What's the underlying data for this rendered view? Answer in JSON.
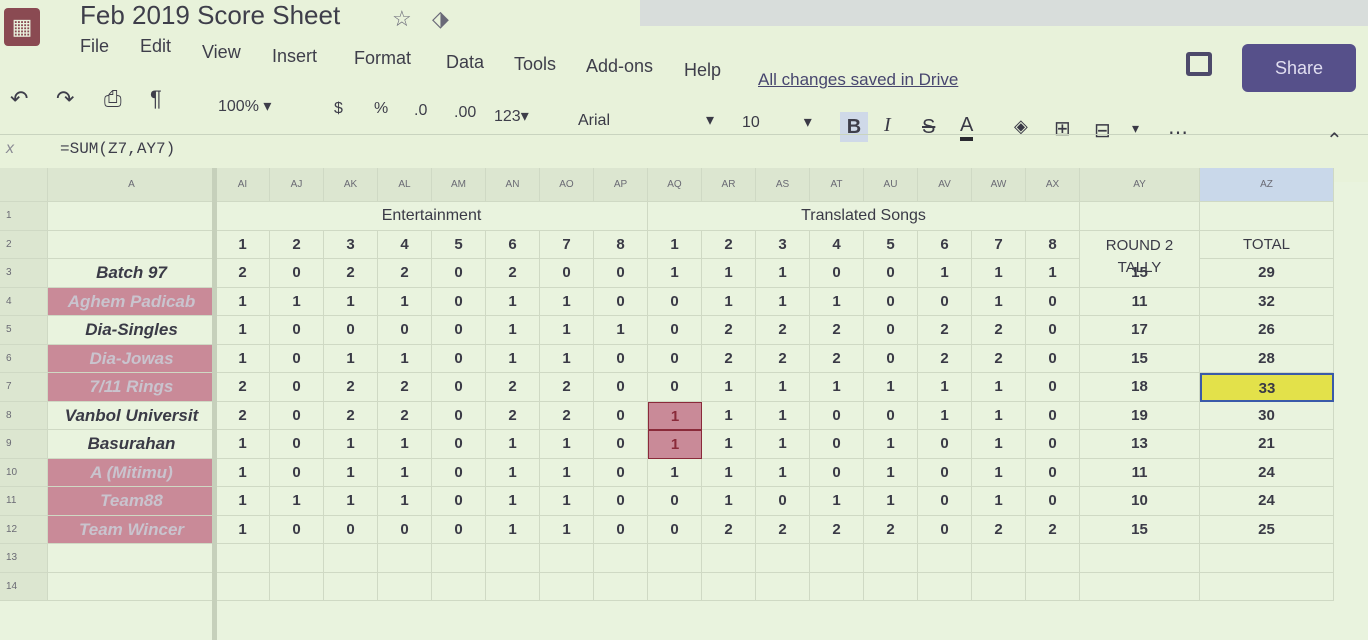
{
  "app": {
    "doc_title": "Feb 2019 Score Sheet",
    "status": "All changes saved in Drive",
    "share_label": "Share"
  },
  "menu": [
    "File",
    "Edit",
    "View",
    "Insert",
    "Format",
    "Data",
    "Tools",
    "Add-ons",
    "Help"
  ],
  "toolbar": {
    "zoom": "100%",
    "currency": "$",
    "percent": "%",
    "dec_less": ".0",
    "dec_more": ".00",
    "format_more": "123",
    "font": "Arial",
    "font_size": "10",
    "bold": "B",
    "italic": "I",
    "strike": "S",
    "text_color": "A"
  },
  "formula": {
    "text": "=SUM(Z7,AY7)"
  },
  "columns": {
    "a": "A",
    "letters": [
      "AI",
      "AJ",
      "AK",
      "AL",
      "AM",
      "AN",
      "AO",
      "AP",
      "AQ",
      "AR",
      "AS",
      "AT",
      "AU",
      "AV",
      "AW",
      "AX"
    ],
    "ay": "AY",
    "az": "AZ"
  },
  "sections": {
    "entertainment": "Entertainment",
    "translated": "Translated Songs",
    "round2": "ROUND 2",
    "tally": "TALLY",
    "total": "TOTAL"
  },
  "row_numbers": [
    "1",
    "2",
    "3",
    "4",
    "5",
    "6",
    "7",
    "8",
    "9",
    "10",
    "11",
    "12",
    "13",
    "14"
  ],
  "subheaders": [
    "1",
    "2",
    "3",
    "4",
    "5",
    "6",
    "7",
    "8",
    "1",
    "2",
    "3",
    "4",
    "5",
    "6",
    "7",
    "8"
  ],
  "teams": [
    {
      "name": "Batch 97",
      "scores": [
        "2",
        "0",
        "2",
        "2",
        "0",
        "2",
        "0",
        "0",
        "1",
        "1",
        "1",
        "0",
        "0",
        "1",
        "1",
        "1"
      ],
      "tally": "15",
      "total": "29"
    },
    {
      "name": "Aghem Padicab",
      "scores": [
        "1",
        "1",
        "1",
        "1",
        "0",
        "1",
        "1",
        "0",
        "0",
        "1",
        "1",
        "1",
        "0",
        "0",
        "1",
        "0"
      ],
      "tally": "11",
      "total": "32"
    },
    {
      "name": "Dia-Singles",
      "scores": [
        "1",
        "0",
        "0",
        "0",
        "0",
        "1",
        "1",
        "1",
        "0",
        "2",
        "2",
        "2",
        "0",
        "2",
        "2",
        "0"
      ],
      "tally": "17",
      "total": "26"
    },
    {
      "name": "Dia-Jowas",
      "scores": [
        "1",
        "0",
        "1",
        "1",
        "0",
        "1",
        "1",
        "0",
        "0",
        "2",
        "2",
        "2",
        "0",
        "2",
        "2",
        "0"
      ],
      "tally": "15",
      "total": "28"
    },
    {
      "name": "7/11 Rings",
      "scores": [
        "2",
        "0",
        "2",
        "2",
        "0",
        "2",
        "2",
        "0",
        "0",
        "1",
        "1",
        "1",
        "1",
        "1",
        "1",
        "0"
      ],
      "tally": "18",
      "total": "33"
    },
    {
      "name": "Vanbol Universit",
      "scores": [
        "2",
        "0",
        "2",
        "2",
        "0",
        "2",
        "2",
        "0",
        "1",
        "1",
        "1",
        "0",
        "0",
        "1",
        "1",
        "0"
      ],
      "tally": "19",
      "total": "30"
    },
    {
      "name": "Basurahan",
      "scores": [
        "1",
        "0",
        "1",
        "1",
        "0",
        "1",
        "1",
        "0",
        "1",
        "1",
        "1",
        "0",
        "1",
        "0",
        "1",
        "0"
      ],
      "tally": "13",
      "total": "21"
    },
    {
      "name": "A (Mitimu)",
      "scores": [
        "1",
        "0",
        "1",
        "1",
        "0",
        "1",
        "1",
        "0",
        "1",
        "1",
        "1",
        "0",
        "1",
        "0",
        "1",
        "0"
      ],
      "tally": "11",
      "total": "24"
    },
    {
      "name": "Team88",
      "scores": [
        "1",
        "1",
        "1",
        "1",
        "0",
        "1",
        "1",
        "0",
        "0",
        "1",
        "0",
        "1",
        "1",
        "0",
        "1",
        "0"
      ],
      "tally": "10",
      "total": "24"
    },
    {
      "name": "Team Wincer",
      "scores": [
        "1",
        "0",
        "0",
        "0",
        "0",
        "1",
        "1",
        "0",
        "0",
        "2",
        "2",
        "2",
        "2",
        "0",
        "2",
        "2"
      ],
      "tally": "15",
      "total": "25"
    }
  ]
}
